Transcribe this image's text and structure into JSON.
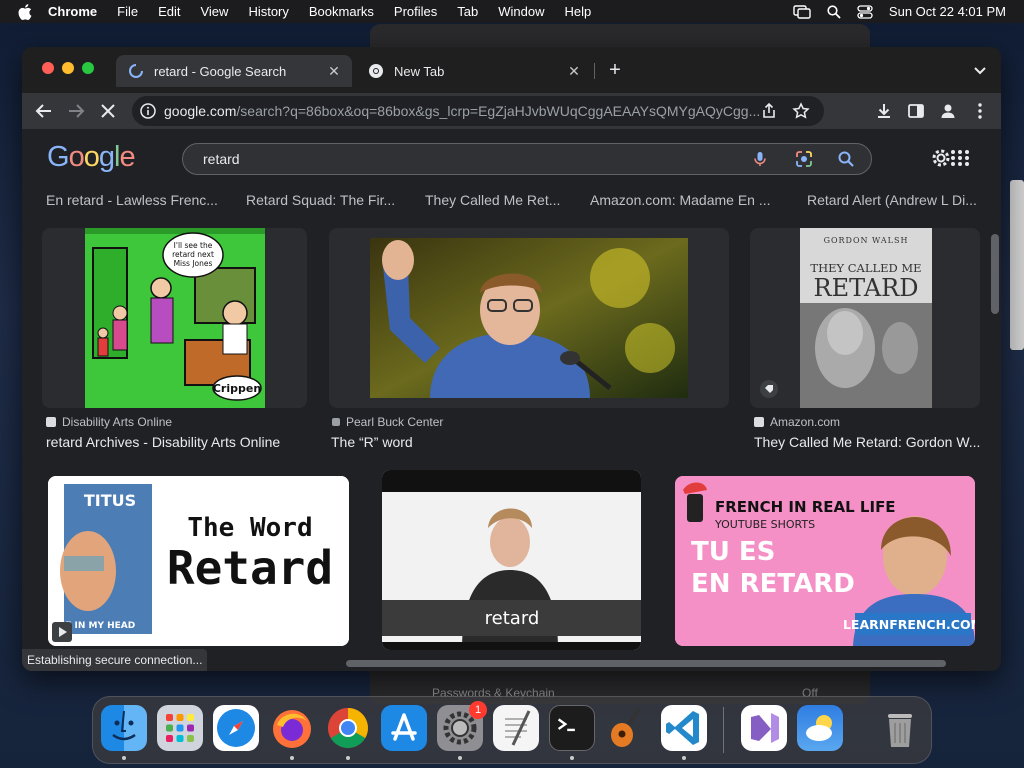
{
  "menubar": {
    "app": "Chrome",
    "items": [
      "File",
      "Edit",
      "View",
      "History",
      "Bookmarks",
      "Profiles",
      "Tab",
      "Window",
      "Help"
    ],
    "datetime": "Sun Oct 22  4:01 PM"
  },
  "tabs": [
    {
      "title": "retard - Google Search",
      "active": true
    },
    {
      "title": "New Tab",
      "active": false
    }
  ],
  "omnibox": {
    "host": "google.com",
    "path": "/search?q=86box&oq=86box&gs_lcrp=EgZjaHJvbWUqCggAEAAYsQMYgAQyCgg..."
  },
  "google": {
    "logo": "Google",
    "query": "retard"
  },
  "top_captions": [
    "En retard - Lawless Frenc...",
    "Retard Squad: The Fir...",
    "They Called Me Ret...",
    "Amazon.com: Madame En ...",
    "Retard Alert (Andrew L Di..."
  ],
  "results_row1": [
    {
      "source": "Disability Arts Online",
      "title": "retard Archives - Disability Arts Online",
      "img_text": {
        "bubble": "I'll see the retard next Miss Jones",
        "signature": "Crippen"
      }
    },
    {
      "source": "Pearl Buck Center",
      "title": "The “R” word"
    },
    {
      "source": "Amazon.com",
      "title": "They Called Me Retard: Gordon W...",
      "img_text": {
        "author": "GORDON WALSH",
        "line1": "THEY CALLED ME",
        "line2": "RETARD"
      }
    }
  ],
  "results_row2": [
    {
      "img_text": {
        "brand": "TITUS",
        "line1": "The Word",
        "line2": "Retard",
        "sub": "VOICE IN MY HEAD"
      }
    },
    {
      "img_text": {
        "caption": "retard"
      }
    },
    {
      "img_text": {
        "line1": "FRENCH IN REAL LIFE",
        "line2": "YOUTUBE SHORTS",
        "line3": "TU ES",
        "line4": "EN RETARD",
        "site": "LEARNFRENCH.COM"
      }
    }
  ],
  "status": "Establishing secure connection...",
  "background_window": {
    "row": "Passwords & Keychain",
    "value": "Off"
  },
  "dock": {
    "apps": [
      "Finder",
      "Launchpad",
      "Safari",
      "Firefox",
      "Chrome",
      "App Store",
      "System Settings",
      "TextEdit",
      "Terminal",
      "GarageBand",
      "VS Code",
      "Visual Studio",
      "Weather",
      "Trash"
    ],
    "settings_badge": "1"
  },
  "colors": {
    "google_blue": "#8ab4f8",
    "google_red": "#f28b82",
    "google_yellow": "#fdd663",
    "google_green": "#81c995",
    "traffic_red": "#ff5f57",
    "traffic_yellow": "#febc2e",
    "traffic_green": "#28c840"
  }
}
